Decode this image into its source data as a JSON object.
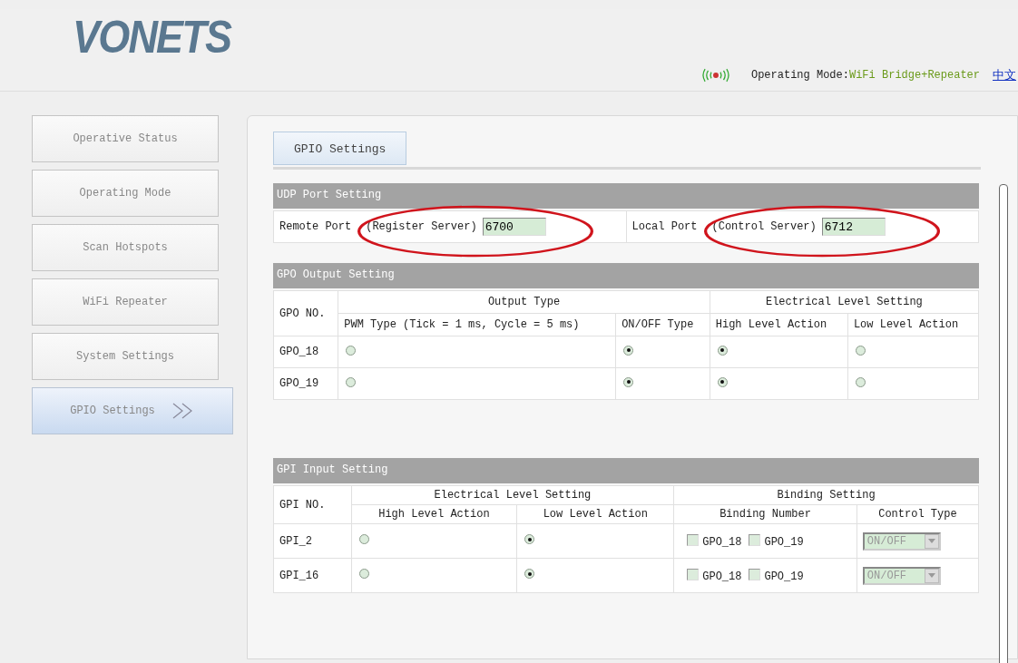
{
  "header": {
    "logo": "VONETS",
    "mode_label": "Operating Mode:",
    "mode_value": "WiFi Bridge+Repeater",
    "language_link": "中文"
  },
  "sidebar": {
    "items": [
      {
        "label": "Operative Status",
        "selected": false
      },
      {
        "label": "Operating Mode",
        "selected": false
      },
      {
        "label": "Scan Hotspots",
        "selected": false
      },
      {
        "label": "WiFi Repeater",
        "selected": false
      },
      {
        "label": "System Settings",
        "selected": false
      },
      {
        "label": "GPIO Settings",
        "selected": true
      }
    ]
  },
  "tabs": [
    {
      "label": "GPIO Settings",
      "selected": true
    }
  ],
  "udp": {
    "title": "UDP Port Setting",
    "fields": [
      {
        "label": "Remote Port",
        "hint": "(Register Server)",
        "value": "6700"
      },
      {
        "label": "Local Port",
        "hint": "(Control Server)",
        "value": "6712"
      }
    ]
  },
  "gpo": {
    "title": "GPO Output Setting",
    "no_header": "GPO NO.",
    "output_type_header": "Output Type",
    "level_header": "Electrical Level Setting",
    "pwm_header": "PWM Type (Tick = 1 ms, Cycle = 5 ms)",
    "onoff_header": "ON/OFF Type",
    "high_header": "High Level Action",
    "low_header": "Low Level Action",
    "rows": [
      {
        "name": "GPO_18",
        "pwm_selected": false,
        "onoff_selected": true,
        "high_selected": true,
        "low_selected": false
      },
      {
        "name": "GPO_19",
        "pwm_selected": false,
        "onoff_selected": true,
        "high_selected": true,
        "low_selected": false
      }
    ]
  },
  "gpi": {
    "title": "GPI Input Setting",
    "no_header": "GPI NO.",
    "level_header": "Electrical Level Setting",
    "binding_header": "Binding Setting",
    "high_header": "High Level Action",
    "low_header": "Low Level Action",
    "number_header": "Binding Number",
    "control_header": "Control Type",
    "rows": [
      {
        "name": "GPI_2",
        "high_selected": false,
        "low_selected": true,
        "bindings": [
          {
            "label": "GPO_18",
            "checked": false
          },
          {
            "label": "GPO_19",
            "checked": false
          }
        ],
        "control_type": "ON/OFF",
        "disabled": true
      },
      {
        "name": "GPI_16",
        "high_selected": false,
        "low_selected": true,
        "bindings": [
          {
            "label": "GPO_18",
            "checked": false
          },
          {
            "label": "GPO_19",
            "checked": false
          }
        ],
        "control_type": "ON/OFF",
        "disabled": true
      }
    ]
  }
}
